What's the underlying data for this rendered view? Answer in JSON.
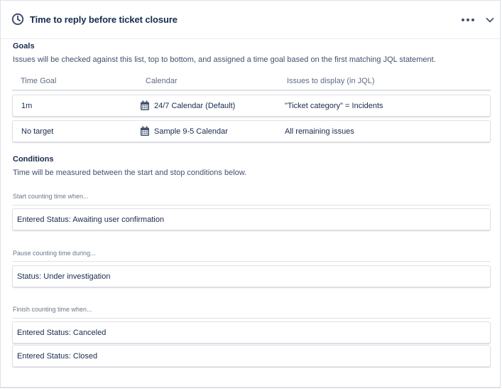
{
  "panel": {
    "title": "Time to reply before ticket closure",
    "icons": {
      "title": "clock-icon",
      "more": "more-icon",
      "toggle": "chevron-down-icon"
    }
  },
  "goals": {
    "heading": "Goals",
    "description": "Issues will be checked against this list, top to bottom, and assigned a time goal based on the first matching JQL statement.",
    "columns": [
      "Time Goal",
      "Calendar",
      "Issues to display (in JQL)"
    ],
    "rows": [
      {
        "time_goal": "1m",
        "calendar": "24/7 Calendar (Default)",
        "jql": "\"Ticket category\" = Incidents"
      },
      {
        "time_goal": "No target",
        "calendar": "Sample 9-5 Calendar",
        "jql": "All remaining issues"
      }
    ]
  },
  "conditions": {
    "heading": "Conditions",
    "description": "Time will be measured between the start and stop conditions below.",
    "start": {
      "label": "Start counting time when...",
      "items": [
        "Entered Status: Awaiting user confirmation"
      ]
    },
    "pause": {
      "label": "Pause counting time during...",
      "items": [
        "Status: Under investigation"
      ]
    },
    "finish": {
      "label": "Finish counting time when...",
      "items": [
        "Entered Status: Canceled",
        "Entered Status: Closed"
      ]
    }
  },
  "colors": {
    "text": "#172b4d",
    "subtle": "#42526e",
    "muted": "#6b778c",
    "border": "#dfe1e6"
  }
}
